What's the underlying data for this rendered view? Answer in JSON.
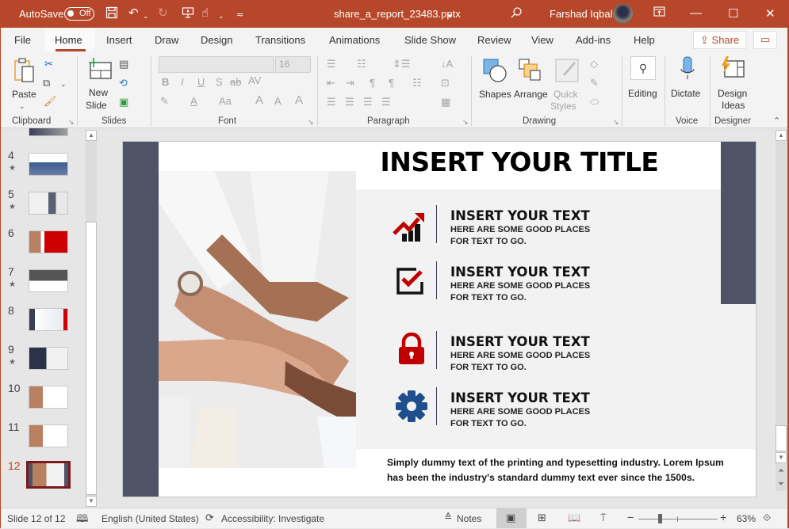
{
  "titlebar": {
    "autosave_label": "AutoSave",
    "autosave_state": "Off",
    "filename": "share_a_report_23483.pptx",
    "user_name": "Farshad Iqbal"
  },
  "menu": {
    "tabs": [
      "File",
      "Home",
      "Insert",
      "Draw",
      "Design",
      "Transitions",
      "Animations",
      "Slide Show",
      "Review",
      "View",
      "Add-ins",
      "Help"
    ],
    "active_tab": "Home",
    "share_label": "Share"
  },
  "ribbon": {
    "clipboard": {
      "paste": "Paste",
      "label": "Clipboard"
    },
    "slides": {
      "new_slide_1": "New",
      "new_slide_2": "Slide",
      "label": "Slides"
    },
    "font": {
      "font_name": "",
      "font_size": "16",
      "label": "Font"
    },
    "paragraph": {
      "label": "Paragraph"
    },
    "drawing": {
      "shapes": "Shapes",
      "arrange": "Arrange",
      "quick_styles_1": "Quick",
      "quick_styles_2": "Styles",
      "label": "Drawing"
    },
    "editing": {
      "label": "Editing"
    },
    "voice": {
      "dictate": "Dictate",
      "label": "Voice"
    },
    "designer": {
      "design_ideas_1": "Design",
      "design_ideas_2": "Ideas",
      "label": "Designer"
    }
  },
  "thumbnails": [
    {
      "num": "4",
      "starred": true
    },
    {
      "num": "5",
      "starred": true
    },
    {
      "num": "6",
      "starred": false
    },
    {
      "num": "7",
      "starred": true
    },
    {
      "num": "8",
      "starred": false
    },
    {
      "num": "9",
      "starred": true
    },
    {
      "num": "10",
      "starred": false
    },
    {
      "num": "11",
      "starred": false
    },
    {
      "num": "12",
      "starred": false,
      "active": true
    }
  ],
  "slide": {
    "title": "INSERT YOUR TITLE",
    "items": [
      {
        "icon": "chart-growth-icon",
        "heading": "INSERT YOUR TEXT",
        "line1": "HERE ARE SOME GOOD PLACES",
        "line2": "FOR TEXT TO GO."
      },
      {
        "icon": "checkbox-icon",
        "heading": "INSERT YOUR TEXT",
        "line1": "HERE ARE SOME GOOD PLACES",
        "line2": "FOR TEXT TO GO."
      },
      {
        "icon": "lock-icon",
        "heading": "INSERT YOUR TEXT",
        "line1": "HERE ARE SOME GOOD PLACES",
        "line2": "FOR TEXT TO GO."
      },
      {
        "icon": "gear-icon",
        "heading": "INSERT YOUR TEXT",
        "line1": "HERE ARE SOME GOOD PLACES",
        "line2": "FOR TEXT TO GO."
      }
    ],
    "footer_line1": "Simply dummy text of the printing and typesetting industry.  Lorem Ipsum",
    "footer_line2": "has been the industry's standard dummy text ever since the 1500s.",
    "colors": {
      "accent_red": "#c00000",
      "slate": "#4f5366",
      "gear_blue": "#1f4e8c",
      "panel_gray": "#f2f2f2"
    }
  },
  "statusbar": {
    "slide_info": "Slide 12 of 12",
    "language": "English (United States)",
    "accessibility": "Accessibility: Investigate",
    "notes": "Notes",
    "zoom": "63%"
  }
}
